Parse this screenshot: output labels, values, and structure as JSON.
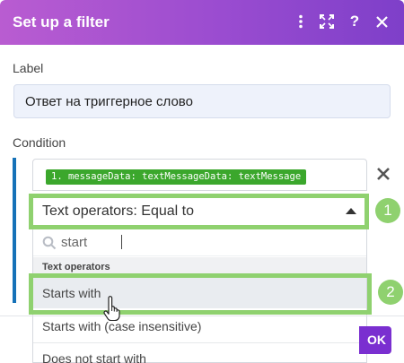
{
  "dialog": {
    "title": "Set up a filter",
    "header_icons": [
      "more-vertical-icon",
      "fullscreen-icon",
      "help-icon",
      "close-icon"
    ]
  },
  "label_section": {
    "label": "Label",
    "value": "Ответ на триггерное слово"
  },
  "condition_section": {
    "label": "Condition",
    "field_chip": "1. messageData: textMessageData: textMessage",
    "operator_selected": "Text operators: Equal to"
  },
  "dropdown": {
    "search_value": "start",
    "group_header": "Text operators",
    "options": [
      "Starts with",
      "Starts with (case insensitive)",
      "Does not start with"
    ],
    "hovered_option": "Starts with"
  },
  "annotations": {
    "step1": "1",
    "step2": "2",
    "highlight_color": "#8fd16f"
  },
  "footer": {
    "ok_label": "OK"
  },
  "colors": {
    "header_gradient_start": "#b95cd1",
    "header_gradient_end": "#7e3fc9",
    "chip_green": "#3ba72c",
    "ok_purple": "#7a2fd0",
    "accent_bar": "#1672b8"
  }
}
